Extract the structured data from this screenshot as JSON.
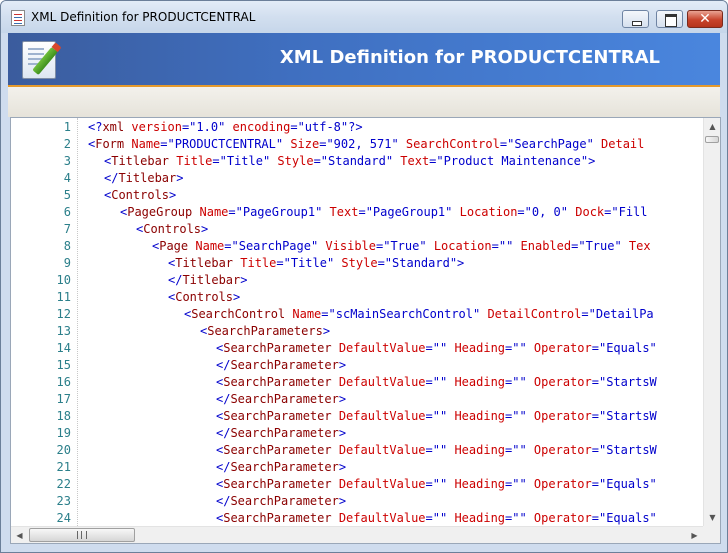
{
  "window": {
    "title": "XML Definition for PRODUCTCENTRAL",
    "close_glyph": "✕"
  },
  "header": {
    "title": "XML Definition for PRODUCTCENTRAL",
    "icon": "document-edit-icon",
    "accent_color": "#e59a2c",
    "banner_color": "#3f6fc0"
  },
  "editor": {
    "colors": {
      "line_number": "#2b7f8a",
      "tag": "#8b0000",
      "attribute": "#cc0000",
      "value": "#0000cc"
    },
    "lines": [
      {
        "n": "1",
        "indent": 0,
        "parts": [
          [
            "eq",
            "<?"
          ],
          [
            "tag",
            "xml"
          ],
          [
            "attr",
            " version"
          ],
          [
            "eq",
            "="
          ],
          [
            "val",
            "\"1.0\""
          ],
          [
            "attr",
            " encoding"
          ],
          [
            "eq",
            "="
          ],
          [
            "val",
            "\"utf-8\""
          ],
          [
            "eq",
            "?>"
          ]
        ]
      },
      {
        "n": "2",
        "indent": 0,
        "parts": [
          [
            "eq",
            "<"
          ],
          [
            "tag",
            "Form"
          ],
          [
            "attr",
            " Name"
          ],
          [
            "eq",
            "="
          ],
          [
            "val",
            "\"PRODUCTCENTRAL\""
          ],
          [
            "attr",
            " Size"
          ],
          [
            "eq",
            "="
          ],
          [
            "val",
            "\"902, 571\""
          ],
          [
            "attr",
            " SearchControl"
          ],
          [
            "eq",
            "="
          ],
          [
            "val",
            "\"SearchPage\""
          ],
          [
            "attr",
            " Detail"
          ]
        ]
      },
      {
        "n": "3",
        "indent": 1,
        "parts": [
          [
            "eq",
            "<"
          ],
          [
            "tag",
            "Titlebar"
          ],
          [
            "attr",
            " Title"
          ],
          [
            "eq",
            "="
          ],
          [
            "val",
            "\"Title\""
          ],
          [
            "attr",
            " Style"
          ],
          [
            "eq",
            "="
          ],
          [
            "val",
            "\"Standard\""
          ],
          [
            "attr",
            " Text"
          ],
          [
            "eq",
            "="
          ],
          [
            "val",
            "\"Product Maintenance\""
          ],
          [
            "eq",
            ">"
          ]
        ]
      },
      {
        "n": "4",
        "indent": 1,
        "parts": [
          [
            "eq",
            "</"
          ],
          [
            "tag",
            "Titlebar"
          ],
          [
            "eq",
            ">"
          ]
        ]
      },
      {
        "n": "5",
        "indent": 1,
        "parts": [
          [
            "eq",
            "<"
          ],
          [
            "tag",
            "Controls"
          ],
          [
            "eq",
            ">"
          ]
        ]
      },
      {
        "n": "6",
        "indent": 2,
        "parts": [
          [
            "eq",
            "<"
          ],
          [
            "tag",
            "PageGroup"
          ],
          [
            "attr",
            " Name"
          ],
          [
            "eq",
            "="
          ],
          [
            "val",
            "\"PageGroup1\""
          ],
          [
            "attr",
            " Text"
          ],
          [
            "eq",
            "="
          ],
          [
            "val",
            "\"PageGroup1\""
          ],
          [
            "attr",
            " Location"
          ],
          [
            "eq",
            "="
          ],
          [
            "val",
            "\"0, 0\""
          ],
          [
            "attr",
            " Dock"
          ],
          [
            "eq",
            "="
          ],
          [
            "val",
            "\"Fill"
          ]
        ]
      },
      {
        "n": "7",
        "indent": 3,
        "parts": [
          [
            "eq",
            "<"
          ],
          [
            "tag",
            "Controls"
          ],
          [
            "eq",
            ">"
          ]
        ]
      },
      {
        "n": "8",
        "indent": 4,
        "parts": [
          [
            "eq",
            "<"
          ],
          [
            "tag",
            "Page"
          ],
          [
            "attr",
            " Name"
          ],
          [
            "eq",
            "="
          ],
          [
            "val",
            "\"SearchPage\""
          ],
          [
            "attr",
            " Visible"
          ],
          [
            "eq",
            "="
          ],
          [
            "val",
            "\"True\""
          ],
          [
            "attr",
            " Location"
          ],
          [
            "eq",
            "="
          ],
          [
            "val",
            "\"\""
          ],
          [
            "attr",
            " Enabled"
          ],
          [
            "eq",
            "="
          ],
          [
            "val",
            "\"True\""
          ],
          [
            "attr",
            " Tex"
          ]
        ]
      },
      {
        "n": "9",
        "indent": 5,
        "parts": [
          [
            "eq",
            "<"
          ],
          [
            "tag",
            "Titlebar"
          ],
          [
            "attr",
            " Title"
          ],
          [
            "eq",
            "="
          ],
          [
            "val",
            "\"Title\""
          ],
          [
            "attr",
            " Style"
          ],
          [
            "eq",
            "="
          ],
          [
            "val",
            "\"Standard\""
          ],
          [
            "eq",
            ">"
          ]
        ]
      },
      {
        "n": "10",
        "indent": 5,
        "parts": [
          [
            "eq",
            "</"
          ],
          [
            "tag",
            "Titlebar"
          ],
          [
            "eq",
            ">"
          ]
        ]
      },
      {
        "n": "11",
        "indent": 5,
        "parts": [
          [
            "eq",
            "<"
          ],
          [
            "tag",
            "Controls"
          ],
          [
            "eq",
            ">"
          ]
        ]
      },
      {
        "n": "12",
        "indent": 6,
        "parts": [
          [
            "eq",
            "<"
          ],
          [
            "tag",
            "SearchControl"
          ],
          [
            "attr",
            " Name"
          ],
          [
            "eq",
            "="
          ],
          [
            "val",
            "\"scMainSearchControl\""
          ],
          [
            "attr",
            " DetailControl"
          ],
          [
            "eq",
            "="
          ],
          [
            "val",
            "\"DetailPa"
          ]
        ]
      },
      {
        "n": "13",
        "indent": 7,
        "parts": [
          [
            "eq",
            "<"
          ],
          [
            "tag",
            "SearchParameters"
          ],
          [
            "eq",
            ">"
          ]
        ]
      },
      {
        "n": "14",
        "indent": 8,
        "parts": [
          [
            "eq",
            "<"
          ],
          [
            "tag",
            "SearchParameter"
          ],
          [
            "attr",
            " DefaultValue"
          ],
          [
            "eq",
            "="
          ],
          [
            "val",
            "\"\""
          ],
          [
            "attr",
            " Heading"
          ],
          [
            "eq",
            "="
          ],
          [
            "val",
            "\"\""
          ],
          [
            "attr",
            " Operator"
          ],
          [
            "eq",
            "="
          ],
          [
            "val",
            "\"Equals\""
          ]
        ]
      },
      {
        "n": "15",
        "indent": 8,
        "parts": [
          [
            "eq",
            "</"
          ],
          [
            "tag",
            "SearchParameter"
          ],
          [
            "eq",
            ">"
          ]
        ]
      },
      {
        "n": "16",
        "indent": 8,
        "parts": [
          [
            "eq",
            "<"
          ],
          [
            "tag",
            "SearchParameter"
          ],
          [
            "attr",
            " DefaultValue"
          ],
          [
            "eq",
            "="
          ],
          [
            "val",
            "\"\""
          ],
          [
            "attr",
            " Heading"
          ],
          [
            "eq",
            "="
          ],
          [
            "val",
            "\"\""
          ],
          [
            "attr",
            " Operator"
          ],
          [
            "eq",
            "="
          ],
          [
            "val",
            "\"StartsW"
          ]
        ]
      },
      {
        "n": "17",
        "indent": 8,
        "parts": [
          [
            "eq",
            "</"
          ],
          [
            "tag",
            "SearchParameter"
          ],
          [
            "eq",
            ">"
          ]
        ]
      },
      {
        "n": "18",
        "indent": 8,
        "parts": [
          [
            "eq",
            "<"
          ],
          [
            "tag",
            "SearchParameter"
          ],
          [
            "attr",
            " DefaultValue"
          ],
          [
            "eq",
            "="
          ],
          [
            "val",
            "\"\""
          ],
          [
            "attr",
            " Heading"
          ],
          [
            "eq",
            "="
          ],
          [
            "val",
            "\"\""
          ],
          [
            "attr",
            " Operator"
          ],
          [
            "eq",
            "="
          ],
          [
            "val",
            "\"StartsW"
          ]
        ]
      },
      {
        "n": "19",
        "indent": 8,
        "parts": [
          [
            "eq",
            "</"
          ],
          [
            "tag",
            "SearchParameter"
          ],
          [
            "eq",
            ">"
          ]
        ]
      },
      {
        "n": "20",
        "indent": 8,
        "parts": [
          [
            "eq",
            "<"
          ],
          [
            "tag",
            "SearchParameter"
          ],
          [
            "attr",
            " DefaultValue"
          ],
          [
            "eq",
            "="
          ],
          [
            "val",
            "\"\""
          ],
          [
            "attr",
            " Heading"
          ],
          [
            "eq",
            "="
          ],
          [
            "val",
            "\"\""
          ],
          [
            "attr",
            " Operator"
          ],
          [
            "eq",
            "="
          ],
          [
            "val",
            "\"StartsW"
          ]
        ]
      },
      {
        "n": "21",
        "indent": 8,
        "parts": [
          [
            "eq",
            "</"
          ],
          [
            "tag",
            "SearchParameter"
          ],
          [
            "eq",
            ">"
          ]
        ]
      },
      {
        "n": "22",
        "indent": 8,
        "parts": [
          [
            "eq",
            "<"
          ],
          [
            "tag",
            "SearchParameter"
          ],
          [
            "attr",
            " DefaultValue"
          ],
          [
            "eq",
            "="
          ],
          [
            "val",
            "\"\""
          ],
          [
            "attr",
            " Heading"
          ],
          [
            "eq",
            "="
          ],
          [
            "val",
            "\"\""
          ],
          [
            "attr",
            " Operator"
          ],
          [
            "eq",
            "="
          ],
          [
            "val",
            "\"Equals\""
          ]
        ]
      },
      {
        "n": "23",
        "indent": 8,
        "parts": [
          [
            "eq",
            "</"
          ],
          [
            "tag",
            "SearchParameter"
          ],
          [
            "eq",
            ">"
          ]
        ]
      },
      {
        "n": "24",
        "indent": 8,
        "parts": [
          [
            "eq",
            "<"
          ],
          [
            "tag",
            "SearchParameter"
          ],
          [
            "attr",
            " DefaultValue"
          ],
          [
            "eq",
            "="
          ],
          [
            "val",
            "\"\""
          ],
          [
            "attr",
            " Heading"
          ],
          [
            "eq",
            "="
          ],
          [
            "val",
            "\"\""
          ],
          [
            "attr",
            " Operator"
          ],
          [
            "eq",
            "="
          ],
          [
            "val",
            "\"Equals\""
          ]
        ]
      }
    ]
  },
  "scrollbars": {
    "up_arrow": "▲",
    "down_arrow": "▼",
    "left_arrow": "◀",
    "right_arrow": "▶"
  }
}
